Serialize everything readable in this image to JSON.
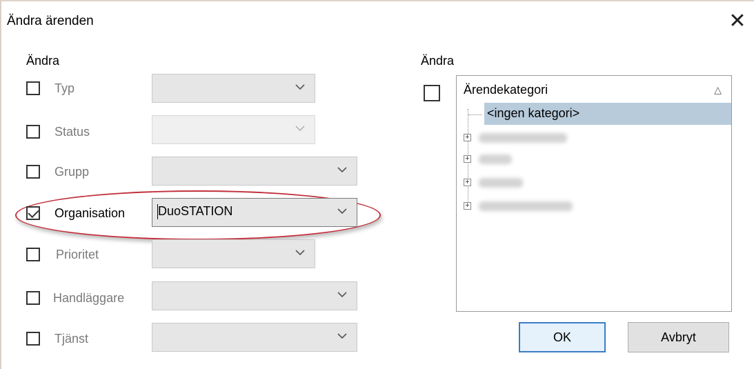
{
  "window": {
    "title": "Ändra ärenden",
    "close_glyph": "✕"
  },
  "left_section": {
    "label": "Ändra",
    "rows": [
      {
        "label": "Typ",
        "checked": false,
        "value": ""
      },
      {
        "label": "Status",
        "checked": false,
        "value": ""
      },
      {
        "label": "Grupp",
        "checked": false,
        "value": ""
      },
      {
        "label": "Organisation",
        "checked": true,
        "value": "DuoSTATION"
      },
      {
        "label": "Prioritet",
        "checked": false,
        "value": ""
      },
      {
        "label": "Handläggare",
        "checked": false,
        "value": ""
      },
      {
        "label": "Tjänst",
        "checked": false,
        "value": ""
      }
    ]
  },
  "right_section": {
    "label": "Ändra",
    "checked": false,
    "tree": {
      "column_header": "Ärendekategori",
      "sort_icon": "sort-ascending-icon",
      "selected_item": "<ingen kategori>",
      "collapsed_items_blurred": 4
    }
  },
  "buttons": {
    "ok": "OK",
    "cancel": "Avbryt"
  },
  "colors": {
    "highlight_ellipse": "#c2313c",
    "selected_row": "#b7cbdb",
    "default_button_border": "#3a7cc4"
  }
}
